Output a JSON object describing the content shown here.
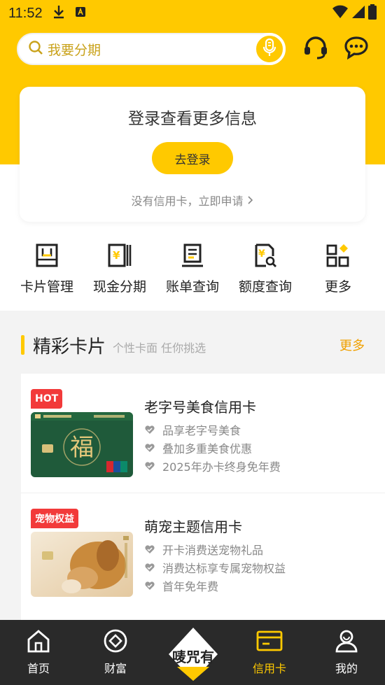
{
  "status_bar": {
    "time": "11:52"
  },
  "search": {
    "placeholder": "我要分期"
  },
  "login_card": {
    "title": "登录查看更多信息",
    "button": "去登录",
    "apply_link": "没有信用卡，立即申请"
  },
  "quick_menu": [
    {
      "label": "卡片管理",
      "icon": "card-manage-icon"
    },
    {
      "label": "现金分期",
      "icon": "cash-installment-icon"
    },
    {
      "label": "账单查询",
      "icon": "bill-query-icon"
    },
    {
      "label": "额度查询",
      "icon": "limit-query-icon"
    },
    {
      "label": "更多",
      "icon": "more-grid-icon"
    }
  ],
  "section": {
    "title": "精彩卡片",
    "subtitle": "个性卡面 任你挑选",
    "more": "更多"
  },
  "cards": [
    {
      "badge": "HOT",
      "name": "老字号美食信用卡",
      "features": [
        "品享老字号美食",
        "叠加多重美食优惠",
        "2025年办卡终身免年费"
      ]
    },
    {
      "badge": "宠物权益",
      "name": "萌宠主题信用卡",
      "features": [
        "开卡消费送宠物礼品",
        "消费达标享专属宠物权益",
        "首年免年费"
      ]
    }
  ],
  "bottom_nav": {
    "items": [
      {
        "label": "首页",
        "icon": "home-icon"
      },
      {
        "label": "财富",
        "icon": "wealth-icon"
      },
      {
        "label": "信用卡",
        "icon": "credit-card-icon",
        "active": true
      },
      {
        "label": "我的",
        "icon": "profile-icon"
      }
    ],
    "center_logo_text": "唛咒有"
  },
  "colors": {
    "brand_yellow": "#ffc900",
    "hot_red": "#f23a3a",
    "nav_bg": "#2a2a2a"
  }
}
